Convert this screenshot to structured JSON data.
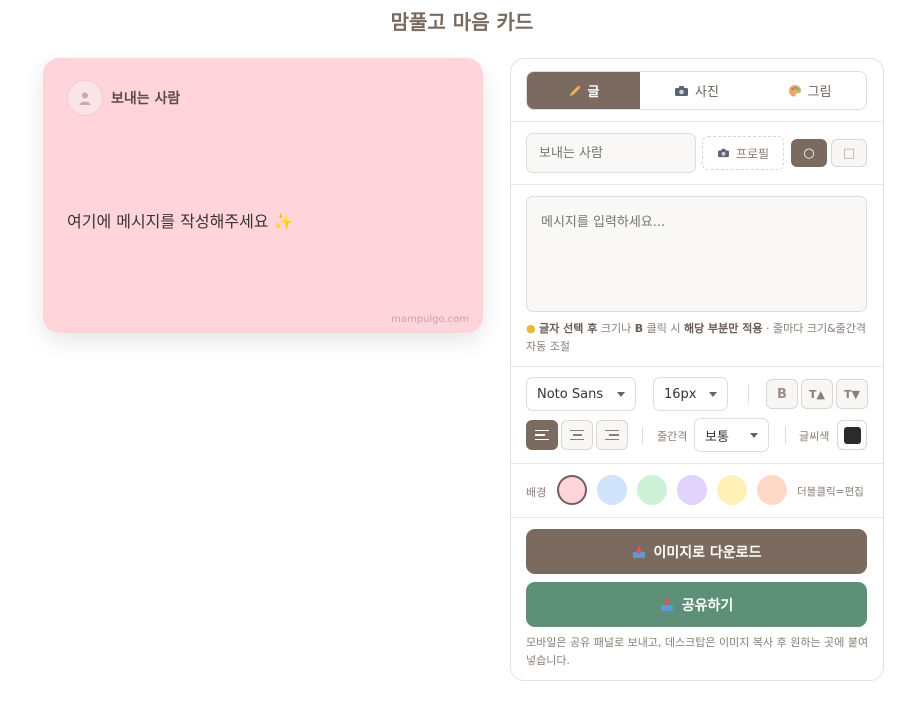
{
  "app": {
    "title": "맘풀고 마음 카드"
  },
  "card": {
    "sender": "보내는 사람",
    "message": "여기에 메시지를 작성해주세요 ✨",
    "watermark": "mampulgo.com",
    "background": "#ffd5db"
  },
  "tabs": [
    {
      "label": "글",
      "icon": "pencil-icon",
      "active": true
    },
    {
      "label": "사진",
      "icon": "camera-icon",
      "active": false
    },
    {
      "label": "그림",
      "icon": "palette-icon",
      "active": false
    }
  ],
  "sender_field": {
    "placeholder": "보내는 사람"
  },
  "profile_button": {
    "label": "프로필",
    "icon": "camera-icon"
  },
  "shape_buttons": {
    "circle": "○",
    "square": "□"
  },
  "message_field": {
    "placeholder": "메시지를 입력하세요..."
  },
  "hint": {
    "part1": "글자 선택 후",
    "part2": " 크기나 ",
    "part3": "B",
    "part4": " 클릭 시 ",
    "part5": "해당 부분만 적용",
    "part6": " · 줄마다 크기&줄간격 자동 조절"
  },
  "format": {
    "font": "Noto Sans",
    "size": "16px",
    "bold_label": "B",
    "size_up_label": "T▲",
    "size_down_label": "T▼",
    "line_height_label": "줄간격",
    "line_height_value": "보통",
    "text_color_label": "글씨색",
    "text_color": "#2b2b2b"
  },
  "background": {
    "label": "배경",
    "colors": [
      "#ffd5db",
      "#cfe3fb",
      "#cdf0d6",
      "#e1d3fb",
      "#fff0b8",
      "#ffd9c8"
    ],
    "selected_index": 0,
    "edit_hint": "더블클릭=편집"
  },
  "download_button": {
    "label": "이미지로 다운로드",
    "color": "#7b6a5f"
  },
  "share_button": {
    "label": "공유하기",
    "color": "#5e8f77"
  },
  "footer_note": "모바일은 공유 패널로 보내고, 데스크탑은 이미지 복사 후 원하는 곳에 붙여넣습니다."
}
